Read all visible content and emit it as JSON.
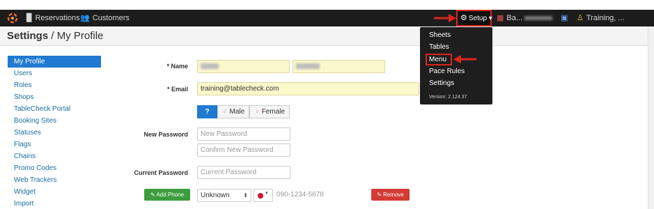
{
  "topbar": {
    "reservations": "Reservations",
    "customers": "Customers",
    "setup": "Setup",
    "shop": "Ba...",
    "user": "Training, ..."
  },
  "header": {
    "title_bold": "Settings",
    "title_rest": " / My Profile"
  },
  "sidebar": {
    "items": [
      {
        "label": "My Profile",
        "active": true
      },
      {
        "label": "Users"
      },
      {
        "label": "Roles"
      },
      {
        "label": "Shops"
      },
      {
        "label": "TableCheck Portal"
      },
      {
        "label": "Booking Sites"
      },
      {
        "label": "Statuses"
      },
      {
        "label": "Flags"
      },
      {
        "label": "Chains"
      },
      {
        "label": "Promo Codes"
      },
      {
        "label": "Web Trackers"
      },
      {
        "label": "Widget"
      },
      {
        "label": "Import"
      }
    ]
  },
  "form": {
    "name_label": "Name",
    "email_label": "Email",
    "email_value": "training@tablecheck.com",
    "gender_unknown": "?",
    "gender_male": "Male",
    "gender_female": "Female",
    "new_password_label": "New Password",
    "new_password_placeholder": "New Password",
    "confirm_password_placeholder": "Confirm New Password",
    "current_password_label": "Current Password",
    "current_password_placeholder": "Current Password",
    "add_phone": "Add Phone",
    "phone_type": "Unknown",
    "phone_placeholder": "090-1234-5678",
    "remove": "Remove"
  },
  "setup_menu": {
    "items": [
      "Sheets",
      "Tables",
      "Menu",
      "Pace Rules",
      "Settings"
    ],
    "version": "Version: 2.124.37"
  },
  "colors": {
    "accent": "#1f7ad1",
    "highlight": "#d9261c",
    "add": "#3d9c3d",
    "remove": "#d33b35"
  }
}
